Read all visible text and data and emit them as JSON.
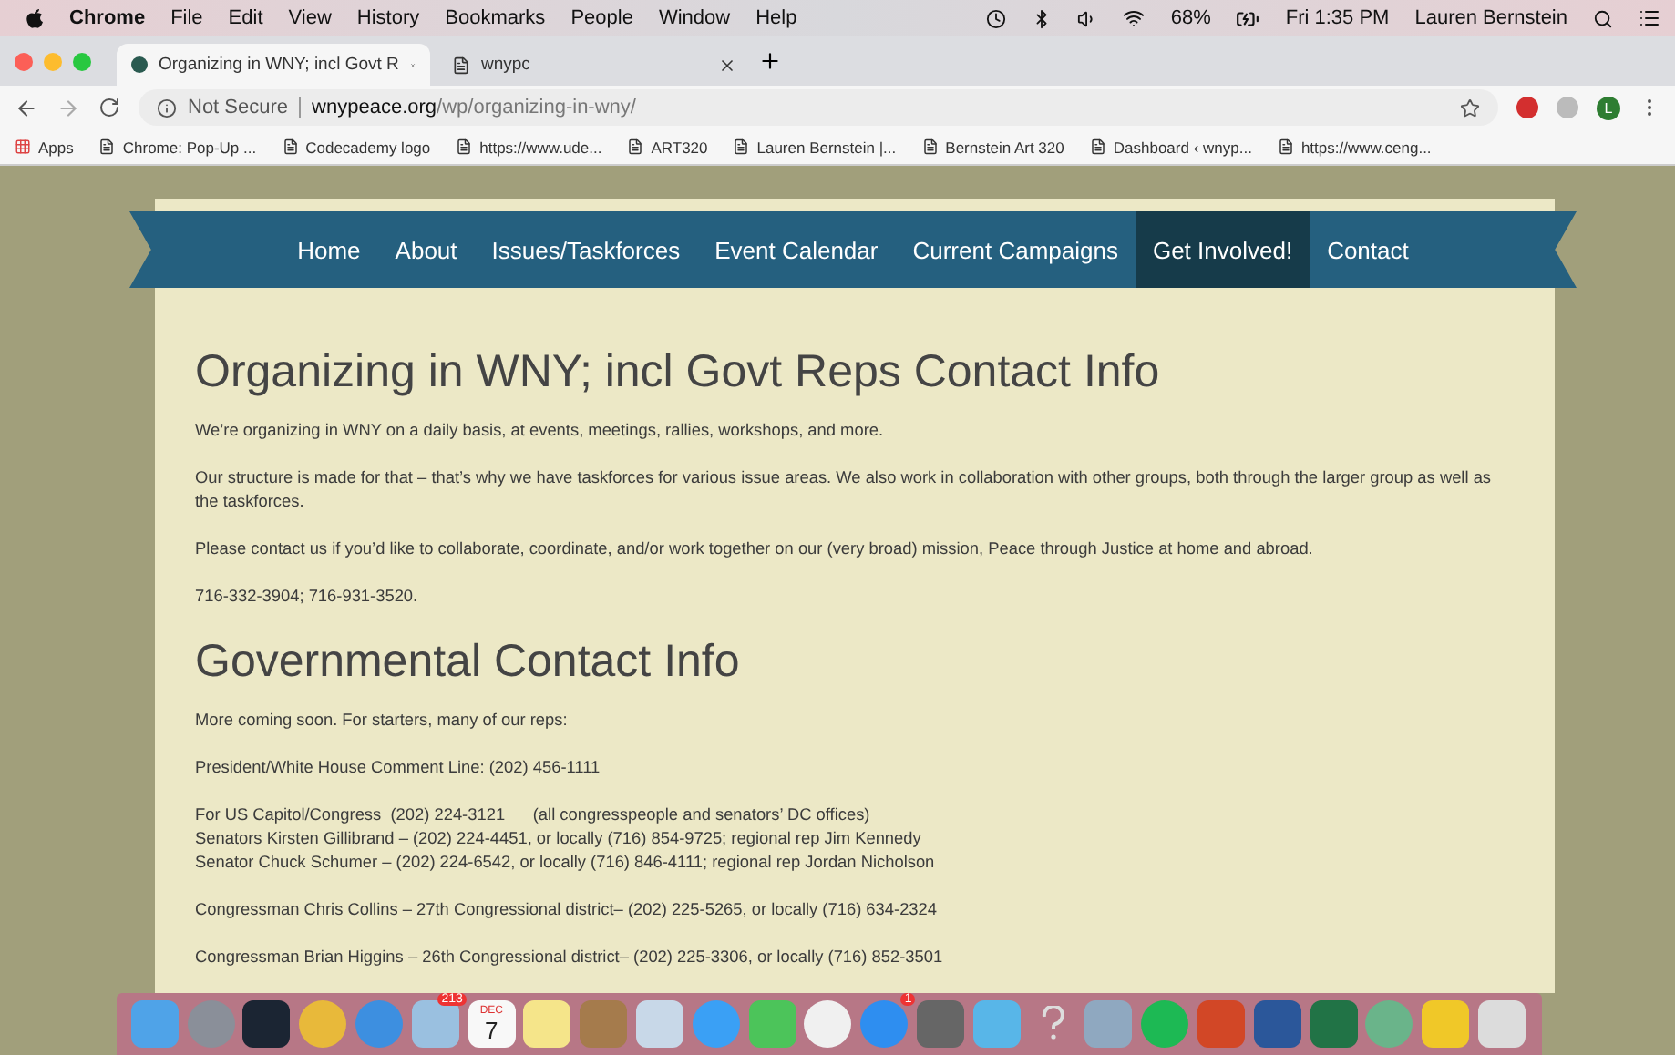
{
  "menu_bar": {
    "app": "Chrome",
    "menus": [
      "File",
      "Edit",
      "View",
      "History",
      "Bookmarks",
      "People",
      "Window",
      "Help"
    ],
    "battery": "68%",
    "clock": "Fri 1:35 PM",
    "user": "Lauren Bernstein"
  },
  "tabs": [
    {
      "title": "Organizing in WNY; incl Govt R",
      "selected": true
    },
    {
      "title": "wnypc",
      "selected": false
    }
  ],
  "address_bar": {
    "security": "Not Secure",
    "host": "wnypeace.org",
    "path": "/wp/organizing-in-wny/",
    "profile": "L"
  },
  "bookmarks": [
    "Apps",
    "Chrome: Pop-Up ...",
    "Codecademy logo",
    "https://www.ude...",
    "ART320",
    "Lauren Bernstein |...",
    "Bernstein Art 320",
    "Dashboard ‹ wnyp...",
    "https://www.ceng..."
  ],
  "nav": [
    {
      "label": "Home",
      "selected": false
    },
    {
      "label": "About",
      "selected": false
    },
    {
      "label": "Issues/Taskforces",
      "selected": false
    },
    {
      "label": "Event Calendar",
      "selected": false
    },
    {
      "label": "Current Campaigns",
      "selected": false
    },
    {
      "label": "Get Involved!",
      "selected": true
    },
    {
      "label": "Contact",
      "selected": false
    }
  ],
  "content": [
    {
      "kind": "heading",
      "lines": [
        "Organizing in WNY; incl Govt Reps Contact Info"
      ]
    },
    {
      "kind": "paragraph",
      "lines": [
        "We’re organizing in WNY on a daily basis, at events, meetings, rallies, workshops, and more."
      ]
    },
    {
      "kind": "paragraph",
      "lines": [
        "Our structure is made for that – that’s why we have taskforces for various issue areas. We also work in collaboration with other groups, both through the larger group as well as the taskforces."
      ]
    },
    {
      "kind": "paragraph",
      "lines": [
        "Please contact us if you’d like to collaborate, coordinate, and/or work together on our (very broad) mission, Peace through Justice at home and abroad."
      ]
    },
    {
      "kind": "paragraph",
      "lines": [
        "716-332-3904; 716-931-3520."
      ]
    },
    {
      "kind": "heading",
      "lines": [
        "Governmental Contact Info"
      ]
    },
    {
      "kind": "paragraph",
      "lines": [
        "More coming soon. For starters, many of our reps:"
      ]
    },
    {
      "kind": "paragraph",
      "lines": [
        "President/White House Comment Line: (202) 456-1111"
      ]
    },
    {
      "kind": "paragraph",
      "lines": [
        "For US Capitol/Congress  (202) 224-3121      (all congresspeople and senators’ DC offices)",
        "Senators Kirsten Gillibrand – (202) 224-4451, or locally (716) 854-9725; regional rep Jim Kennedy",
        "Senator Chuck Schumer – (202) 224-6542, or locally (716) 846-4111; regional rep Jordan Nicholson"
      ]
    },
    {
      "kind": "paragraph",
      "lines": [
        "Congressman Chris Collins – 27th Congressional district– (202) 225-5265, or locally (716) 634-2324"
      ]
    },
    {
      "kind": "paragraph",
      "lines": [
        "Congressman Brian Higgins – 26th Congressional district– (202) 225-3306, or locally (716) 852-3501"
      ]
    }
  ],
  "dock": [
    {
      "kind": "finder"
    },
    {
      "kind": "launchpad"
    },
    {
      "kind": "app"
    },
    {
      "kind": "chrome"
    },
    {
      "kind": "safari"
    },
    {
      "kind": "mail",
      "badge": "213"
    },
    {
      "kind": "calendar",
      "month": "DEC",
      "day": "7"
    },
    {
      "kind": "notes"
    },
    {
      "kind": "contacts"
    },
    {
      "kind": "preview"
    },
    {
      "kind": "messages"
    },
    {
      "kind": "facetime"
    },
    {
      "kind": "photos"
    },
    {
      "kind": "appstore",
      "badge": "1"
    },
    {
      "kind": "settings"
    },
    {
      "kind": "messenger"
    },
    {
      "kind": "help"
    },
    {
      "kind": "network"
    },
    {
      "kind": "spotify"
    },
    {
      "kind": "powerpoint"
    },
    {
      "kind": "word"
    },
    {
      "kind": "excel"
    },
    {
      "kind": "atom"
    },
    {
      "kind": "duck"
    },
    {
      "kind": "trash"
    }
  ]
}
